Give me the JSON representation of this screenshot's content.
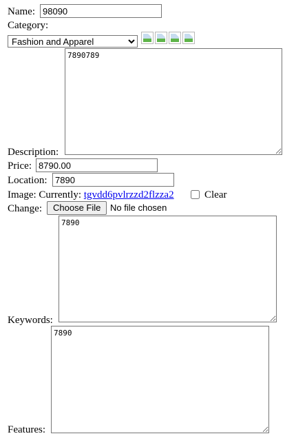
{
  "form": {
    "name": {
      "label": "Name:",
      "value": "98090"
    },
    "category": {
      "label": "Category:",
      "selected": "Fashion and Apparel",
      "thumbnails": [
        "broken-image-icon",
        "broken-image-icon",
        "broken-image-icon",
        "broken-image-icon"
      ]
    },
    "description": {
      "label": "Description:",
      "value": "7890789"
    },
    "price": {
      "label": "Price:",
      "value": "8790.00"
    },
    "location": {
      "label": "Location:",
      "value": "7890"
    },
    "image": {
      "label": "Image:",
      "currently_label": "Currently:",
      "current_file": "tgvdd6pvlrzzd2flzza2",
      "clear_label": "Clear",
      "change_label": "Change:",
      "choose_button": "Choose File",
      "file_status": "No file chosen"
    },
    "keywords": {
      "label": "Keywords:",
      "value": "7890"
    },
    "features": {
      "label": "Features:",
      "value": "7890"
    }
  }
}
